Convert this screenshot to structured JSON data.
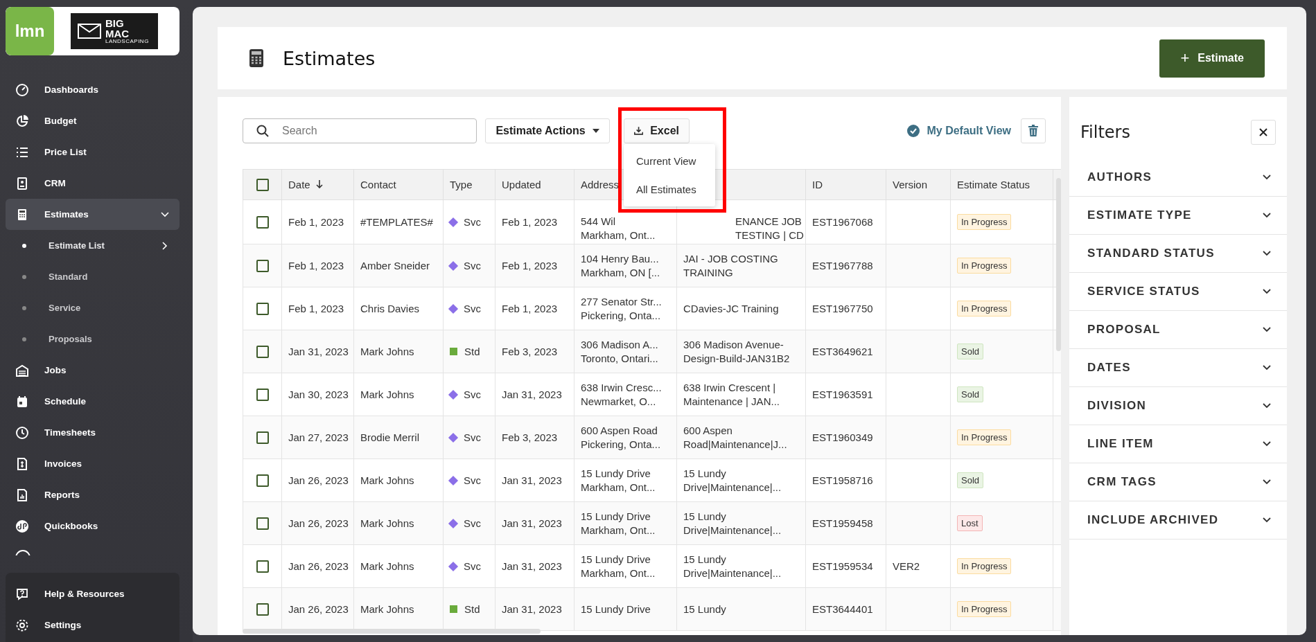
{
  "sidebar": {
    "logo": {
      "brand": "lmn",
      "partner": [
        "BIG",
        "MAC",
        "LANDSCAPING"
      ]
    },
    "items": [
      {
        "label": "Dashboards",
        "selected": false
      },
      {
        "label": "Budget",
        "selected": false
      },
      {
        "label": "Price List",
        "selected": false
      },
      {
        "label": "CRM",
        "selected": false
      },
      {
        "label": "Estimates",
        "selected": true,
        "expanded": true,
        "children": [
          {
            "label": "Estimate List",
            "selected": true
          },
          {
            "label": "Standard",
            "selected": false
          },
          {
            "label": "Service",
            "selected": false
          },
          {
            "label": "Proposals",
            "selected": false
          }
        ]
      },
      {
        "label": "Jobs",
        "selected": false
      },
      {
        "label": "Schedule",
        "selected": false
      },
      {
        "label": "Timesheets",
        "selected": false
      },
      {
        "label": "Invoices",
        "selected": false
      },
      {
        "label": "Reports",
        "selected": false
      },
      {
        "label": "Quickbooks",
        "selected": false
      }
    ],
    "footer": [
      {
        "label": "Help & Resources"
      },
      {
        "label": "Settings"
      }
    ]
  },
  "header": {
    "title": "Estimates",
    "button": "Estimate",
    "button_icon": "+"
  },
  "toolbar": {
    "search": {
      "placeholder": "Search"
    },
    "actions": "Estimate Actions",
    "excel": "Excel",
    "excel_menu": {
      "expanded": true,
      "items": [
        "Current View",
        "All Estimates"
      ]
    },
    "view": "My Default View"
  },
  "table": {
    "all_checked": false,
    "columns": [
      {
        "label": "Date",
        "sorted": true
      },
      {
        "label": "Contact"
      },
      {
        "label": "Type"
      },
      {
        "label": "Updated"
      },
      {
        "label": "Address"
      },
      null,
      {
        "label": "ID"
      },
      {
        "label": "Version"
      },
      {
        "label": "Estimate Status"
      }
    ],
    "rows": [
      {
        "checked": false,
        "date": "Feb 1, 2023",
        "contact": "#TEMPLATES#",
        "type": {
          "kind": "svc",
          "label": "Svc"
        },
        "updated": "Feb 1, 2023",
        "address": [
          "544 Wil",
          "Markham, Ont..."
        ],
        "name": [
          "ENANCE JOB",
          "TESTING | CD"
        ],
        "id": "EST1967068",
        "version": "",
        "status": {
          "kind": "in_progress",
          "label": "In Progress"
        }
      },
      {
        "checked": false,
        "date": "Feb 1, 2023",
        "contact": "Amber Sneider",
        "type": {
          "kind": "svc",
          "label": "Svc"
        },
        "updated": "Feb 1, 2023",
        "address": [
          "104 Henry Bau...",
          "Markham, ON [..."
        ],
        "name": [
          "JAI - JOB COSTING",
          "TRAINING"
        ],
        "id": "EST1967788",
        "version": "",
        "status": {
          "kind": "in_progress",
          "label": "In Progress"
        }
      },
      {
        "checked": false,
        "date": "Feb 1, 2023",
        "contact": "Chris Davies",
        "type": {
          "kind": "svc",
          "label": "Svc"
        },
        "updated": "Feb 1, 2023",
        "address": [
          "277 Senator Str...",
          "Pickering, Onta..."
        ],
        "name": [
          "CDavies-JC Training"
        ],
        "id": "EST1967750",
        "version": "",
        "status": {
          "kind": "in_progress",
          "label": "In Progress"
        }
      },
      {
        "checked": false,
        "date": "Jan 31, 2023",
        "contact": "Mark Johns",
        "type": {
          "kind": "std",
          "label": "Std"
        },
        "updated": "Feb 3, 2023",
        "address": [
          "306 Madison A...",
          "Toronto, Ontari..."
        ],
        "name": [
          "306 Madison Avenue-",
          "Design-Build-JAN31B2"
        ],
        "id": "EST3649621",
        "version": "",
        "status": {
          "kind": "sold",
          "label": "Sold"
        }
      },
      {
        "checked": false,
        "date": "Jan 30, 2023",
        "contact": "Mark Johns",
        "type": {
          "kind": "svc",
          "label": "Svc"
        },
        "updated": "Jan 31, 2023",
        "address": [
          "638 Irwin Cresc...",
          "Newmarket, O..."
        ],
        "name": [
          "638 Irwin Crescent |",
          "Maintenance | JAN..."
        ],
        "id": "EST1963591",
        "version": "",
        "status": {
          "kind": "sold",
          "label": "Sold"
        }
      },
      {
        "checked": false,
        "date": "Jan 27, 2023",
        "contact": "Brodie Merril",
        "type": {
          "kind": "svc",
          "label": "Svc"
        },
        "updated": "Feb 3, 2023",
        "address": [
          "600 Aspen Road",
          "Pickering, Onta..."
        ],
        "name": [
          "600 Aspen",
          "Road|Maintenance|J..."
        ],
        "id": "EST1960349",
        "version": "",
        "status": {
          "kind": "in_progress",
          "label": "In Progress"
        }
      },
      {
        "checked": false,
        "date": "Jan 26, 2023",
        "contact": "Mark Johns",
        "type": {
          "kind": "svc",
          "label": "Svc"
        },
        "updated": "Jan 31, 2023",
        "address": [
          "15 Lundy Drive",
          "Markham, Ont..."
        ],
        "name": [
          "15 Lundy",
          "Drive|Maintenance|..."
        ],
        "id": "EST1958716",
        "version": "",
        "status": {
          "kind": "sold",
          "label": "Sold"
        }
      },
      {
        "checked": false,
        "date": "Jan 26, 2023",
        "contact": "Mark Johns",
        "type": {
          "kind": "svc",
          "label": "Svc"
        },
        "updated": "Jan 31, 2023",
        "address": [
          "15 Lundy Drive",
          "Markham, Ont..."
        ],
        "name": [
          "15 Lundy",
          "Drive|Maintenance|..."
        ],
        "id": "EST1959458",
        "version": "",
        "status": {
          "kind": "lost",
          "label": "Lost"
        }
      },
      {
        "checked": false,
        "date": "Jan 26, 2023",
        "contact": "Mark Johns",
        "type": {
          "kind": "svc",
          "label": "Svc"
        },
        "updated": "Jan 31, 2023",
        "address": [
          "15 Lundy Drive",
          "Markham, Ont..."
        ],
        "name": [
          "15 Lundy",
          "Drive|Maintenance|..."
        ],
        "id": "EST1959534",
        "version": "VER2",
        "status": {
          "kind": "in_progress",
          "label": "In Progress"
        }
      },
      {
        "checked": false,
        "date": "Jan 26, 2023",
        "contact": "Mark Johns",
        "type": {
          "kind": "std",
          "label": "Std"
        },
        "updated": "Jan 31, 2023",
        "address": [
          "15 Lundy Drive"
        ],
        "name": [
          "15 Lundy"
        ],
        "id": "EST3644401",
        "version": "",
        "status": {
          "kind": "in_progress",
          "label": "In Progress"
        }
      }
    ]
  },
  "filters": {
    "title": "Filters",
    "items": [
      {
        "label": "AUTHORS",
        "expanded": false
      },
      {
        "label": "ESTIMATE TYPE",
        "expanded": false
      },
      {
        "label": "STANDARD STATUS",
        "expanded": false
      },
      {
        "label": "SERVICE STATUS",
        "expanded": false
      },
      {
        "label": "PROPOSAL",
        "expanded": false
      },
      {
        "label": "DATES",
        "expanded": false
      },
      {
        "label": "DIVISION",
        "expanded": false
      },
      {
        "label": "LINE ITEM",
        "expanded": false
      },
      {
        "label": "CRM TAGS",
        "expanded": false
      },
      {
        "label": "INCLUDE ARCHIVED",
        "expanded": false
      }
    ]
  }
}
